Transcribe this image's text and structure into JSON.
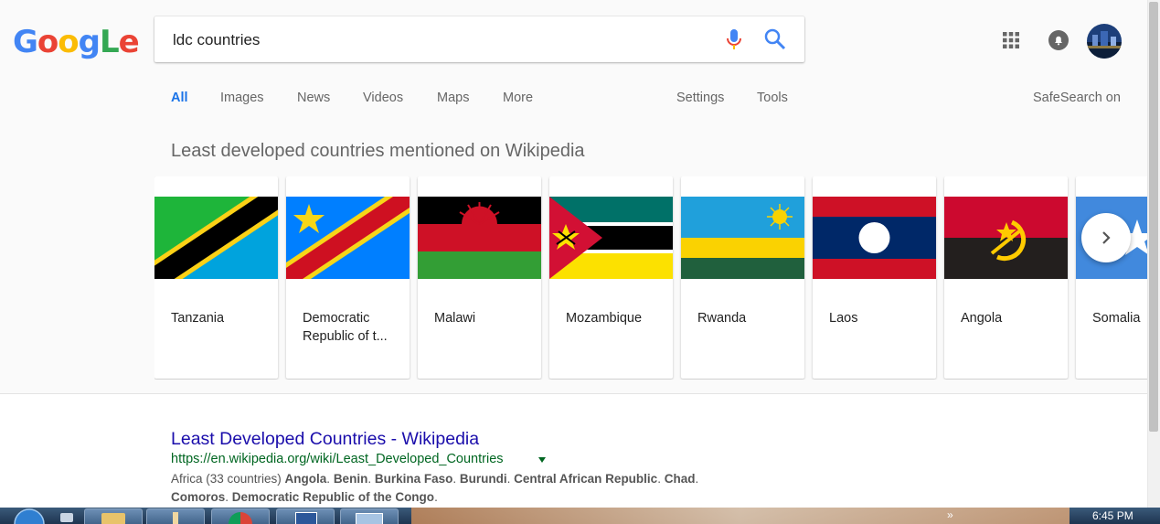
{
  "logo": {
    "letters": [
      "G",
      "o",
      "o",
      "g",
      "L",
      "e"
    ]
  },
  "search": {
    "query": "ldc countries"
  },
  "header": {
    "icons": [
      "mic-icon",
      "search-icon",
      "apps-icon",
      "notifications-icon",
      "avatar"
    ]
  },
  "tabs": {
    "all": "All",
    "images": "Images",
    "news": "News",
    "videos": "Videos",
    "maps": "Maps",
    "more": "More",
    "settings": "Settings",
    "tools": "Tools"
  },
  "safesearch": "SafeSearch on",
  "carousel": {
    "title": "Least developed countries mentioned on Wikipedia",
    "items": [
      {
        "name": "Tanzania"
      },
      {
        "name": "Democratic Republic of t..."
      },
      {
        "name": "Malawi"
      },
      {
        "name": "Mozambique"
      },
      {
        "name": "Rwanda"
      },
      {
        "name": "Laos"
      },
      {
        "name": "Angola"
      },
      {
        "name": "Somalia"
      }
    ]
  },
  "result": {
    "title": "Least Developed Countries - Wikipedia",
    "url": "https://en.wikipedia.org/wiki/Least_Developed_Countries",
    "snippet_prefix": "Africa (33 countries) ",
    "snippet_items": [
      "Angola",
      "Benin",
      "Burkina Faso",
      "Burundi",
      "Central African Republic",
      "Chad",
      "Comoros",
      "Democratic Republic of the Congo"
    ]
  },
  "taskbar": {
    "clock": "6:45 PM"
  },
  "colors": {
    "accent": "#1a73e8",
    "link": "#1a0dab",
    "url": "#006621"
  }
}
